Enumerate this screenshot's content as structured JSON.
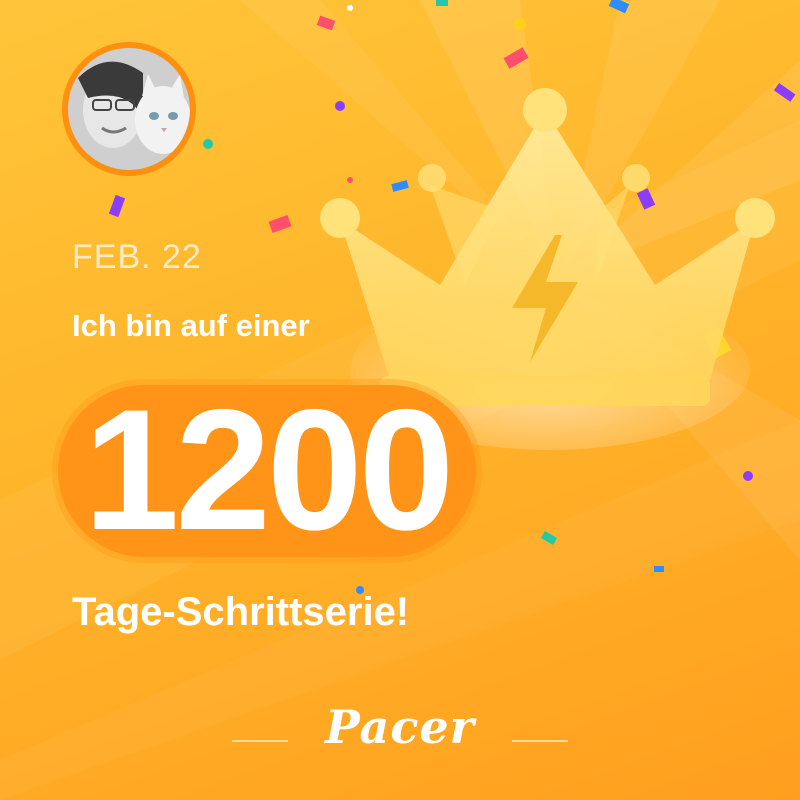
{
  "card": {
    "date": "FEB. 22",
    "line1": "Ich bin auf einer",
    "number": "1200",
    "line2": "Tage-Schrittserie!",
    "brand": "Pacer"
  },
  "colors": {
    "background_top": "#ffc53a",
    "background_bottom": "#ff9f1f",
    "badge": "#ff9418",
    "crown": "#ffe27a",
    "bolt": "#f4b82a",
    "text": "#ffffff"
  },
  "icons": {
    "crown": "crown-icon",
    "bolt": "lightning-bolt-icon",
    "avatar": "profile-photo"
  }
}
